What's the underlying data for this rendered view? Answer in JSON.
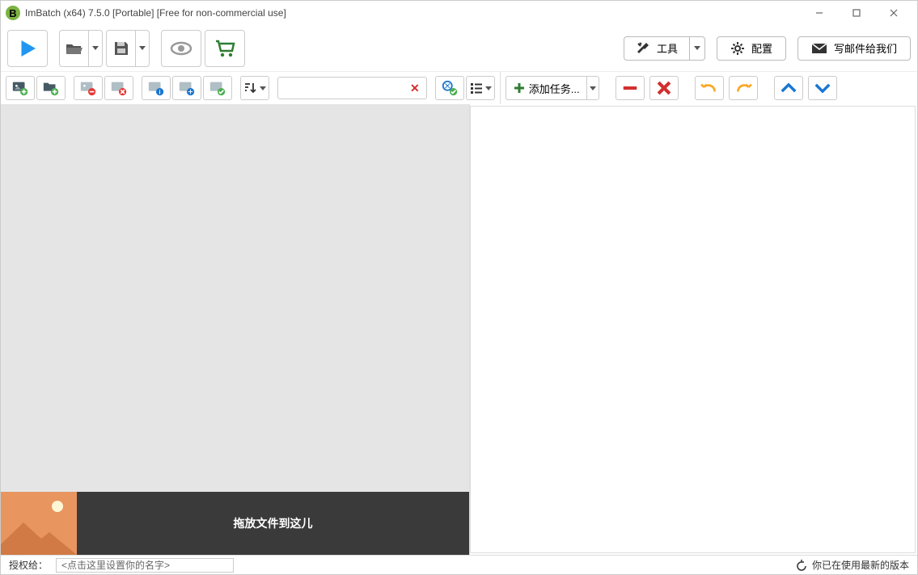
{
  "window": {
    "title": "ImBatch (x64) 7.5.0 [Portable] [Free for non-commercial use]"
  },
  "main_toolbar": {
    "tools_label": "工具",
    "config_label": "配置",
    "email_label": "写邮件给我们"
  },
  "right_toolbar": {
    "add_task_label": "添加任务..."
  },
  "drop_zone": {
    "text": "拖放文件到这儿"
  },
  "status": {
    "license_label": "授权给：",
    "license_placeholder": "<点击这里设置你的名字>",
    "version_status": "你已在使用最新的版本"
  },
  "icons": {
    "play": "play-icon",
    "open": "open-folder-icon",
    "save": "save-icon",
    "preview": "eye-icon",
    "cart": "cart-icon",
    "tools": "wrench-icon",
    "gear": "gear-icon",
    "mail": "mail-icon",
    "add_image": "add-image-icon",
    "add_folder": "add-folder-icon",
    "remove_image": "remove-image-icon",
    "remove_all": "remove-all-icon",
    "info1": "image-info-icon",
    "info2": "image-info2-icon",
    "check": "check-image-icon",
    "sort": "sort-icon",
    "task_check": "task-check-icon",
    "list": "list-icon",
    "plus": "plus-icon",
    "minus": "minus-icon",
    "x": "x-icon",
    "undo": "undo-icon",
    "redo": "redo-icon",
    "up": "up-icon",
    "down": "down-icon",
    "refresh": "refresh-icon"
  }
}
